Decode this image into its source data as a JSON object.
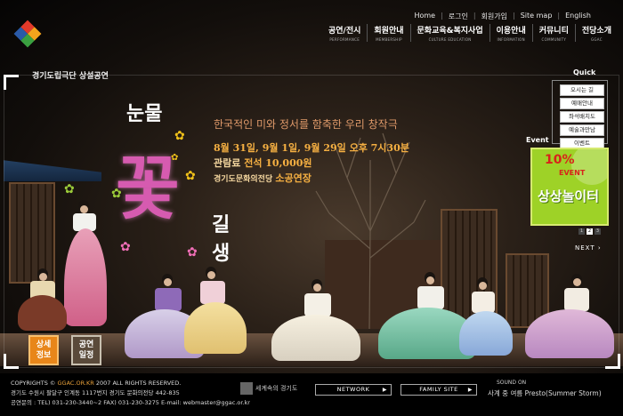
{
  "header": {
    "util_links": [
      "Home",
      "로그인",
      "회원가입",
      "Site map",
      "English"
    ],
    "gnb": [
      {
        "ko": "공연/전시",
        "en": "PERFORMANCE"
      },
      {
        "ko": "회원안내",
        "en": "MEMBERSHIP"
      },
      {
        "ko": "문화교육&복지사업",
        "en": "CULTURE EDUCATION"
      },
      {
        "ko": "이용안내",
        "en": "INFORMATION"
      },
      {
        "ko": "커뮤니티",
        "en": "COMMUNITY"
      },
      {
        "ko": "전당소개",
        "en": "GGAC"
      }
    ]
  },
  "hero": {
    "company": "경기도립극단 상설공연",
    "title_1": "눈물",
    "title_2": "꽃",
    "title_3": "길",
    "title_4": "생",
    "tagline": "한국적인 미와 정서를 함축한 우리 창작극",
    "dates": "8월 31일, 9월 1일, 9월 29일 오후 7시30분",
    "price_label": "관람료 ",
    "price_value": "전석 10,000원",
    "venue_label": "경기도문화의전당 ",
    "venue_value": "소공연장",
    "btn_detail_1": "상세",
    "btn_detail_2": "정보",
    "btn_schedule_1": "공연",
    "btn_schedule_2": "일정"
  },
  "quick": {
    "label": "Quick",
    "items": [
      "오시는 길",
      "예매안내",
      "좌석배치도",
      "예술과만남",
      "이벤트"
    ]
  },
  "event": {
    "label": "Event",
    "pct": "10%",
    "ev": "EVENT",
    "ko": "상상놀이터",
    "pages": [
      "1",
      "2",
      "3"
    ],
    "current_page": 2,
    "next": "NEXT ›"
  },
  "footer": {
    "copyright_prefix": "COPYRIGHTS © ",
    "copyright_site": "GGAC.OR.KR",
    "copyright_suffix": " 2007  ALL RIGHTS RESERVED.",
    "address": "경기도 수원시 팔달구 인계동 1117번지 경기도 문화의전당 442-835",
    "contact": "공연문의 : TEL) 031-230-3440~2  FAX) 031-230-3275  E-mail: webmaster@ggac.or.kr",
    "gg_logo": "세계속의 경기도",
    "network": "NETWORK",
    "family": "FAMILY SITE",
    "sound_label": "SOUND ON",
    "music_title": "사계 중 여름 Presto(Summer Storm)"
  },
  "colors": {
    "accent_orange": "#e8861a",
    "title_pink": "#d65bb0",
    "event_green": "#9ed227"
  }
}
